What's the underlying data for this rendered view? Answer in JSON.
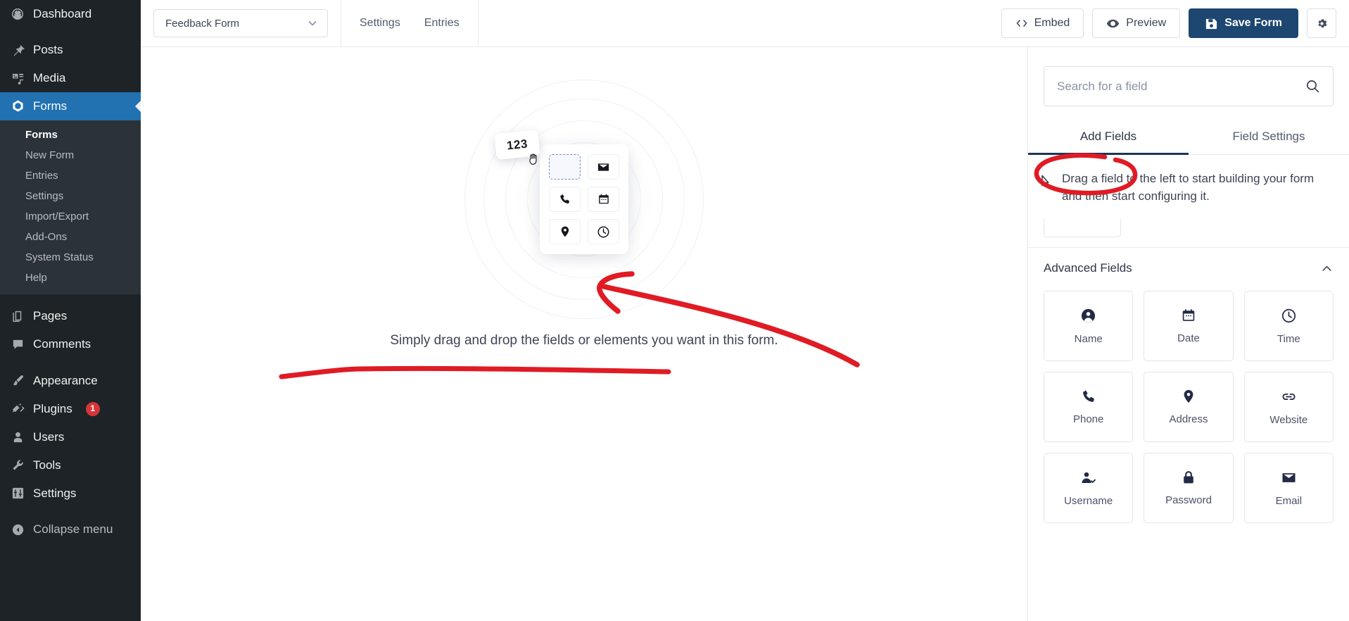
{
  "wp_sidebar": {
    "items": [
      {
        "label": "Dashboard",
        "icon": "dashboard-icon",
        "current": false
      },
      {
        "label": "Posts",
        "icon": "pin-icon",
        "current": false
      },
      {
        "label": "Media",
        "icon": "media-icon",
        "current": false
      },
      {
        "label": "Forms",
        "icon": "forms-icon",
        "current": true
      },
      {
        "label": "Pages",
        "icon": "pages-icon",
        "current": false
      },
      {
        "label": "Comments",
        "icon": "comments-icon",
        "current": false
      },
      {
        "label": "Appearance",
        "icon": "brush-icon",
        "current": false
      },
      {
        "label": "Plugins",
        "icon": "plug-icon",
        "current": false,
        "badge": "1"
      },
      {
        "label": "Users",
        "icon": "user-icon",
        "current": false
      },
      {
        "label": "Tools",
        "icon": "wrench-icon",
        "current": false
      },
      {
        "label": "Settings",
        "icon": "sliders-icon",
        "current": false
      },
      {
        "label": "Collapse menu",
        "icon": "collapse-icon",
        "current": false
      }
    ],
    "submenu": [
      {
        "label": "Forms",
        "active": true
      },
      {
        "label": "New Form",
        "active": false
      },
      {
        "label": "Entries",
        "active": false
      },
      {
        "label": "Settings",
        "active": false
      },
      {
        "label": "Import/Export",
        "active": false
      },
      {
        "label": "Add-Ons",
        "active": false
      },
      {
        "label": "System Status",
        "active": false
      },
      {
        "label": "Help",
        "active": false
      }
    ]
  },
  "toolbar": {
    "form_name": "Feedback Form",
    "tabs": [
      {
        "label": "Settings"
      },
      {
        "label": "Entries"
      }
    ],
    "embed_label": "Embed",
    "preview_label": "Preview",
    "save_label": "Save Form",
    "settings_icon": "gear-icon",
    "primary_color": "#1d4670"
  },
  "canvas": {
    "drag_chip_text": "123",
    "caption": "Simply drag and drop the fields or elements you want in this form.",
    "tiles": [
      {
        "icon": "dropzone-dashed",
        "dropzone": true
      },
      {
        "icon": "envelope-icon",
        "dropzone": false
      },
      {
        "icon": "phone-icon",
        "dropzone": false
      },
      {
        "icon": "calendar-icon",
        "dropzone": false
      },
      {
        "icon": "location-pin-icon",
        "dropzone": false
      },
      {
        "icon": "clock-icon",
        "dropzone": false
      }
    ]
  },
  "annotations": {
    "color": "#e01b24",
    "circle_target": "Add Fields",
    "underline_target": "Simply drag and drop the fields or elements you want in this form.",
    "arrow_from": "Advanced Fields panel",
    "arrow_to": "form canvas"
  },
  "right_panel": {
    "search": {
      "placeholder": "Search for a field",
      "value": "",
      "icon": "search-icon"
    },
    "tabs": [
      {
        "label": "Add Fields",
        "active": true
      },
      {
        "label": "Field Settings",
        "active": false
      }
    ],
    "hint": "Drag a field to the left to start building your form and then start configuring it.",
    "hint_icon": "cursor-arrow-icon",
    "section": {
      "title": "Advanced Fields",
      "collapse_icon": "chevron-up-icon",
      "expanded": true
    },
    "fields": [
      {
        "label": "Name",
        "icon": "person-circle-icon"
      },
      {
        "label": "Date",
        "icon": "calendar-icon"
      },
      {
        "label": "Time",
        "icon": "clock-icon"
      },
      {
        "label": "Phone",
        "icon": "phone-icon"
      },
      {
        "label": "Address",
        "icon": "location-pin-icon"
      },
      {
        "label": "Website",
        "icon": "link-icon"
      },
      {
        "label": "Username",
        "icon": "user-check-icon"
      },
      {
        "label": "Password",
        "icon": "lock-icon"
      },
      {
        "label": "Email",
        "icon": "envelope-icon"
      }
    ]
  }
}
